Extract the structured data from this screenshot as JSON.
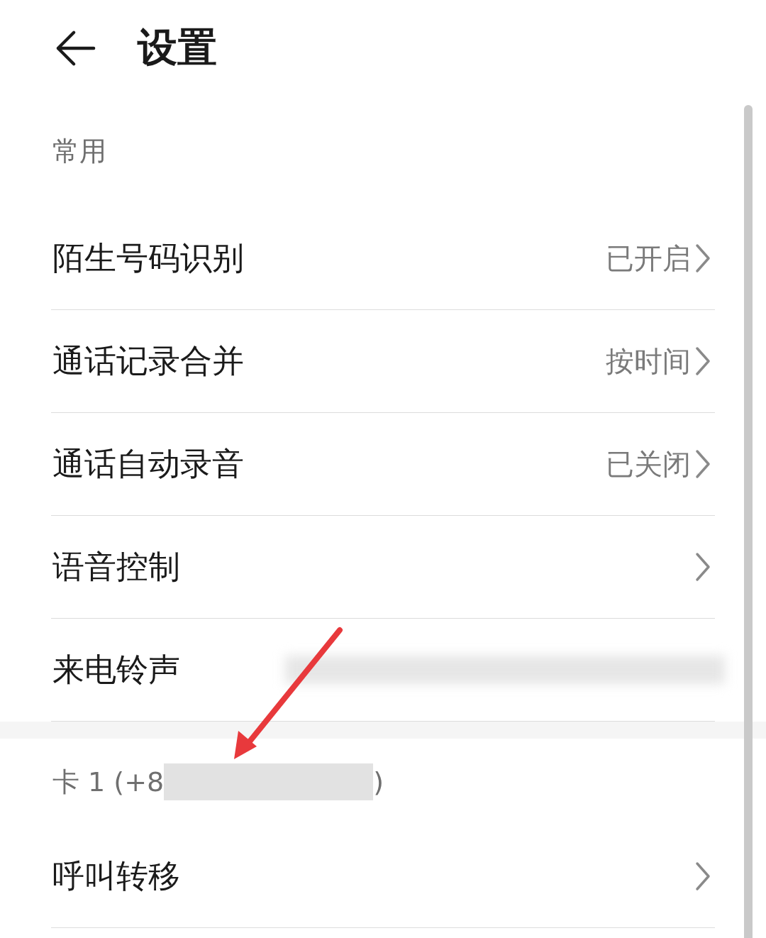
{
  "header": {
    "title": "设置"
  },
  "sections": [
    {
      "label": "常用",
      "rows": [
        {
          "kind": "value",
          "label": "陌生号码识别",
          "value": "已开启"
        },
        {
          "kind": "value",
          "label": "通话记录合并",
          "value": "按时间"
        },
        {
          "kind": "value",
          "label": "通话自动录音",
          "value": "已关闭"
        },
        {
          "kind": "chevron",
          "label": "语音控制"
        },
        {
          "kind": "redacted",
          "label": "来电铃声"
        }
      ]
    },
    {
      "label": "卡 1 (+8",
      "label_end": ")",
      "redacted": true,
      "rows": [
        {
          "kind": "chevron",
          "label": "呼叫转移"
        }
      ]
    }
  ]
}
